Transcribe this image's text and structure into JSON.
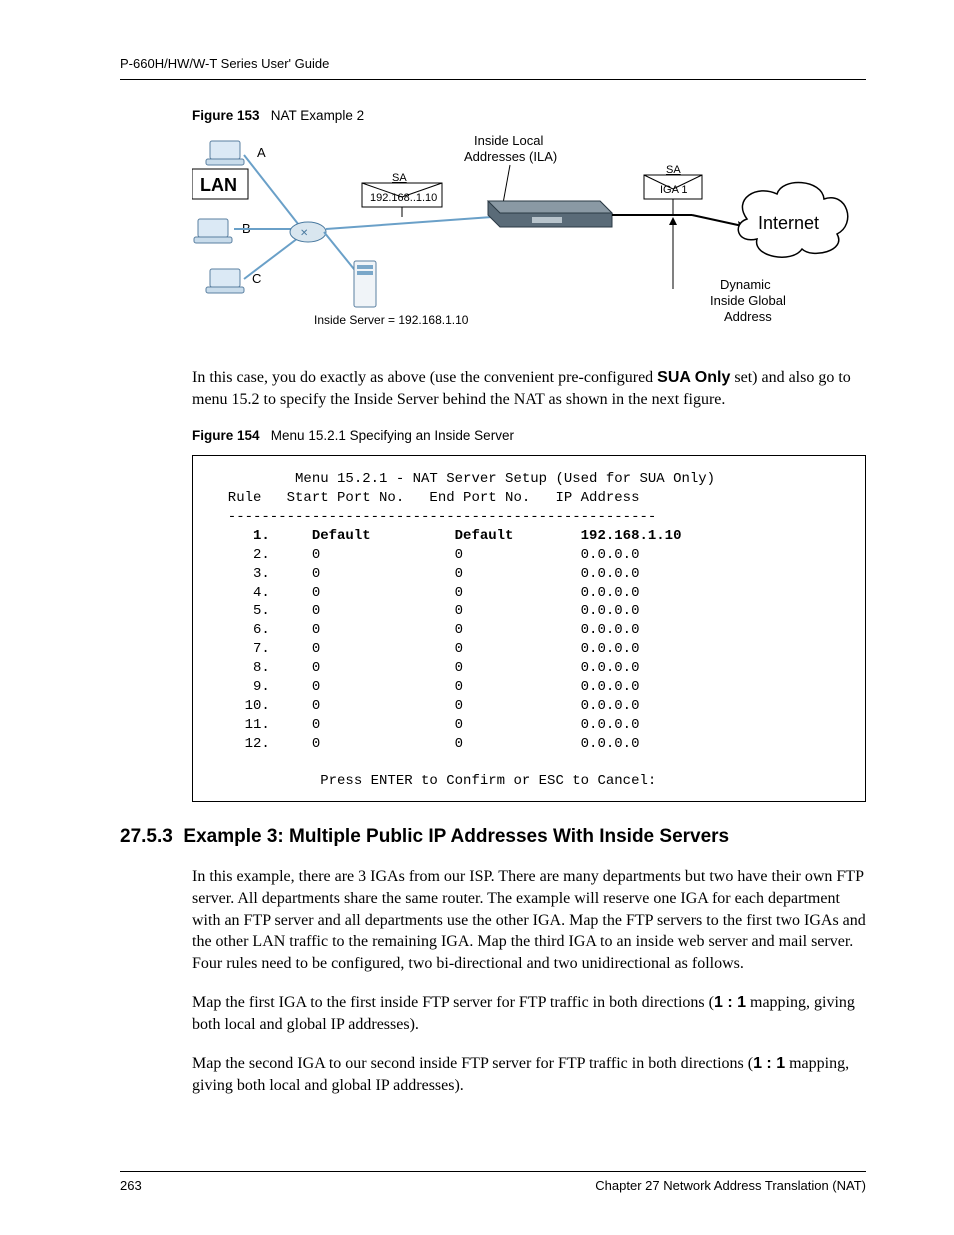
{
  "header": {
    "guide_title": "P-660H/HW/W-T Series User' Guide"
  },
  "figure153": {
    "label": "Figure 153",
    "title": "NAT Example 2",
    "labels": {
      "ila": "Inside Local\nAddresses (ILA)",
      "lan": "LAN",
      "a": "A",
      "b": "B",
      "c": "C",
      "sa1": "SA",
      "ip1": "192.168..1.10",
      "sa2": "SA",
      "iga1": "IGA 1",
      "internet": "Internet",
      "dynamic": "Dynamic\nInside Global\nAddress",
      "inside_server": "Inside Server = 192.168.1.10"
    }
  },
  "para1": {
    "pre": "In this case, you do exactly as above (use the convenient pre-configured ",
    "bold": "SUA Only",
    "post": " set) and also go to menu 15.2 to specify the Inside Server behind the NAT as shown in the next figure."
  },
  "figure154": {
    "label": "Figure 154",
    "title": "Menu 15.2.1 Specifying an Inside Server"
  },
  "terminal": {
    "title": "Menu 15.2.1 - NAT Server Setup (Used for SUA Only)",
    "header": "  Rule   Start Port No.   End Port No.   IP Address",
    "divider": "  ---------------------------------------------------",
    "rows": [
      {
        "n": "1.",
        "start": "Default",
        "end": "Default",
        "ip": "192.168.1.10",
        "bold": true
      },
      {
        "n": "2.",
        "start": "0",
        "end": "0",
        "ip": "0.0.0.0",
        "bold": false
      },
      {
        "n": "3.",
        "start": "0",
        "end": "0",
        "ip": "0.0.0.0",
        "bold": false
      },
      {
        "n": "4.",
        "start": "0",
        "end": "0",
        "ip": "0.0.0.0",
        "bold": false
      },
      {
        "n": "5.",
        "start": "0",
        "end": "0",
        "ip": "0.0.0.0",
        "bold": false
      },
      {
        "n": "6.",
        "start": "0",
        "end": "0",
        "ip": "0.0.0.0",
        "bold": false
      },
      {
        "n": "7.",
        "start": "0",
        "end": "0",
        "ip": "0.0.0.0",
        "bold": false
      },
      {
        "n": "8.",
        "start": "0",
        "end": "0",
        "ip": "0.0.0.0",
        "bold": false
      },
      {
        "n": "9.",
        "start": "0",
        "end": "0",
        "ip": "0.0.0.0",
        "bold": false
      },
      {
        "n": "10.",
        "start": "0",
        "end": "0",
        "ip": "0.0.0.0",
        "bold": false
      },
      {
        "n": "11.",
        "start": "0",
        "end": "0",
        "ip": "0.0.0.0",
        "bold": false
      },
      {
        "n": "12.",
        "start": "0",
        "end": "0",
        "ip": "0.0.0.0",
        "bold": false
      }
    ],
    "footer": "Press ENTER to Confirm or ESC to Cancel:"
  },
  "section": {
    "number": "27.5.3",
    "title": "Example 3: Multiple Public IP Addresses With Inside Servers"
  },
  "para2": "In this example, there are 3 IGAs from our ISP. There are many departments but two have their own FTP server. All departments share the same router. The example will reserve one IGA for each department with an FTP server and all departments use the other IGA. Map the FTP servers to the first two IGAs and the other LAN traffic to the remaining IGA. Map the third IGA to an inside web server and mail server. Four rules need to be configured, two bi-directional and two unidirectional as follows.",
  "para3": {
    "pre": "Map the first IGA to the first inside FTP server for FTP traffic in both directions (",
    "bold": "1 : 1",
    "post": " mapping, giving both local and global IP addresses)."
  },
  "para4": {
    "pre": "Map the second IGA to our second inside FTP server for FTP traffic in both directions (",
    "bold": "1 : 1",
    "post": " mapping, giving both local and global IP addresses)."
  },
  "footer": {
    "page": "263",
    "chapter": "Chapter 27 Network Address Translation (NAT)"
  }
}
